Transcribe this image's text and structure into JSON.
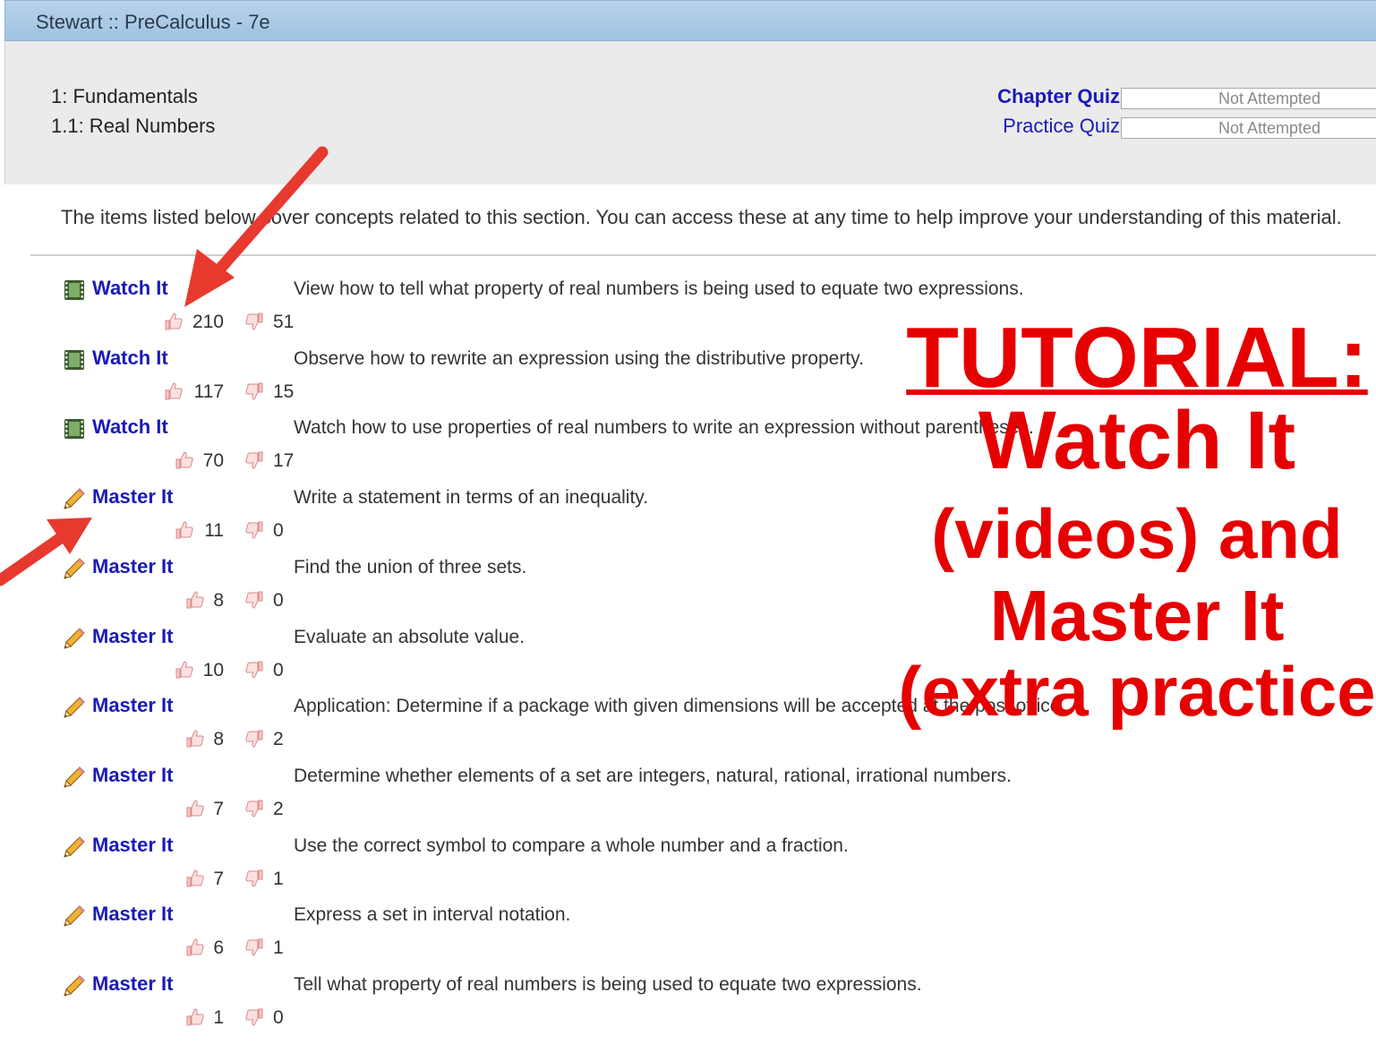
{
  "window": {
    "title": "Stewart :: PreCalculus - 7e"
  },
  "header": {
    "chapter": "1: Fundamentals",
    "section": "1.1: Real Numbers",
    "chapter_quiz": {
      "label": "Chapter Quiz",
      "status": "Not Attempted"
    },
    "practice_quiz": {
      "label": "Practice Quiz",
      "status": "Not Attempted"
    }
  },
  "intro_text": "The items listed below cover concepts related to this section. You can access these at any time to help improve your understanding of this material.",
  "items": [
    {
      "type": "Watch It",
      "icon": "film-icon",
      "description": "View how to tell what property of real numbers is being used to equate two expressions.",
      "likes": "210",
      "dislikes": "51"
    },
    {
      "type": "Watch It",
      "icon": "film-icon",
      "description": "Observe how to rewrite an expression using the distributive property.",
      "likes": "117",
      "dislikes": "15"
    },
    {
      "type": "Watch It",
      "icon": "film-icon",
      "description": "Watch how to use properties of real numbers to write an expression without parentheses.",
      "likes": "70",
      "dislikes": "17"
    },
    {
      "type": "Master It",
      "icon": "pencil-icon",
      "description": "Write a statement in terms of an inequality.",
      "likes": "11",
      "dislikes": "0"
    },
    {
      "type": "Master It",
      "icon": "pencil-icon",
      "description": "Find the union of three sets.",
      "likes": "8",
      "dislikes": "0"
    },
    {
      "type": "Master It",
      "icon": "pencil-icon",
      "description": "Evaluate an absolute value.",
      "likes": "10",
      "dislikes": "0"
    },
    {
      "type": "Master It",
      "icon": "pencil-icon",
      "description": "Application: Determine if a package with given dimensions will be accepted at the post office.",
      "likes": "8",
      "dislikes": "2"
    },
    {
      "type": "Master It",
      "icon": "pencil-icon",
      "description": "Determine whether elements of a set are integers, natural, rational, irrational numbers.",
      "likes": "7",
      "dislikes": "2"
    },
    {
      "type": "Master It",
      "icon": "pencil-icon",
      "description": "Use the correct symbol to compare a whole number and a fraction.",
      "likes": "7",
      "dislikes": "1"
    },
    {
      "type": "Master It",
      "icon": "pencil-icon",
      "description": "Express a set in interval notation.",
      "likes": "6",
      "dislikes": "1"
    },
    {
      "type": "Master It",
      "icon": "pencil-icon",
      "description": "Tell what property of real numbers is being used to equate two expressions.",
      "likes": "1",
      "dislikes": "0"
    }
  ],
  "overlay": {
    "title": "TUTORIAL:",
    "line1": "Watch It",
    "line2": "(videos) and",
    "line3": "Master It",
    "line4": "(extra practice"
  },
  "colors": {
    "link": "#1a1ab8",
    "overlay_text": "#e60000",
    "arrow": "#e8392f",
    "titlebar": "#a9c9e6",
    "header_panel": "#ebebeb"
  }
}
